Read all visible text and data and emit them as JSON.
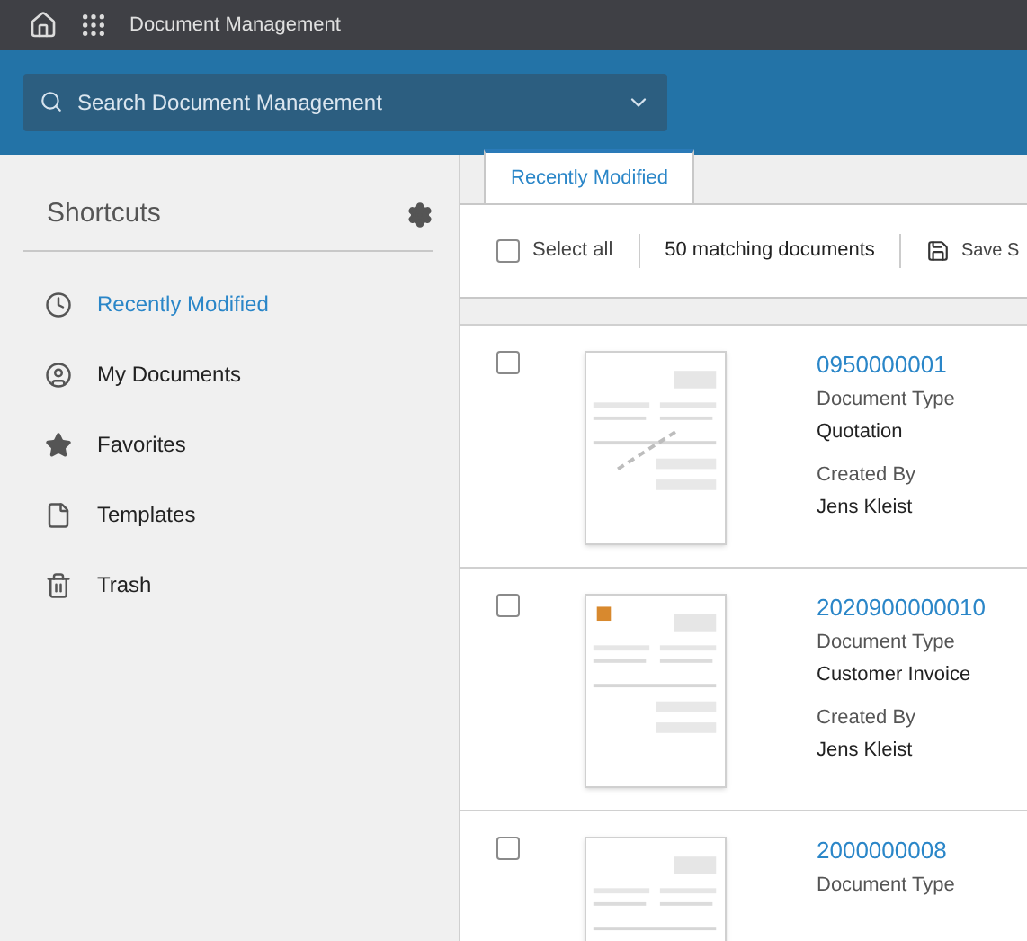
{
  "app_title": "Document Management",
  "search": {
    "placeholder": "Search Document Management"
  },
  "shortcuts": {
    "title": "Shortcuts",
    "items": [
      {
        "label": "Recently Modified",
        "selected": true
      },
      {
        "label": "My Documents",
        "selected": false
      },
      {
        "label": "Favorites",
        "selected": false
      },
      {
        "label": "Templates",
        "selected": false
      },
      {
        "label": "Trash",
        "selected": false
      }
    ]
  },
  "tabs": [
    {
      "label": "Recently Modified",
      "selected": true
    }
  ],
  "toolbar": {
    "select_all": {
      "label": "Select all",
      "checked": false
    },
    "count": "50 matching documents",
    "save": "Save S"
  },
  "documents": [
    {
      "checked": false,
      "number": "0950000001",
      "type_label": "Document Type",
      "type": "Quotation",
      "created_label": "Created By",
      "created_by": "Jens Kleist"
    },
    {
      "checked": false,
      "number": "2020900000010",
      "type_label": "Document Type",
      "type": "Customer Invoice",
      "created_label": "Created By",
      "created_by": "Jens Kleist"
    },
    {
      "checked": false,
      "number": "2000000008",
      "type_label": "Document Type"
    }
  ]
}
